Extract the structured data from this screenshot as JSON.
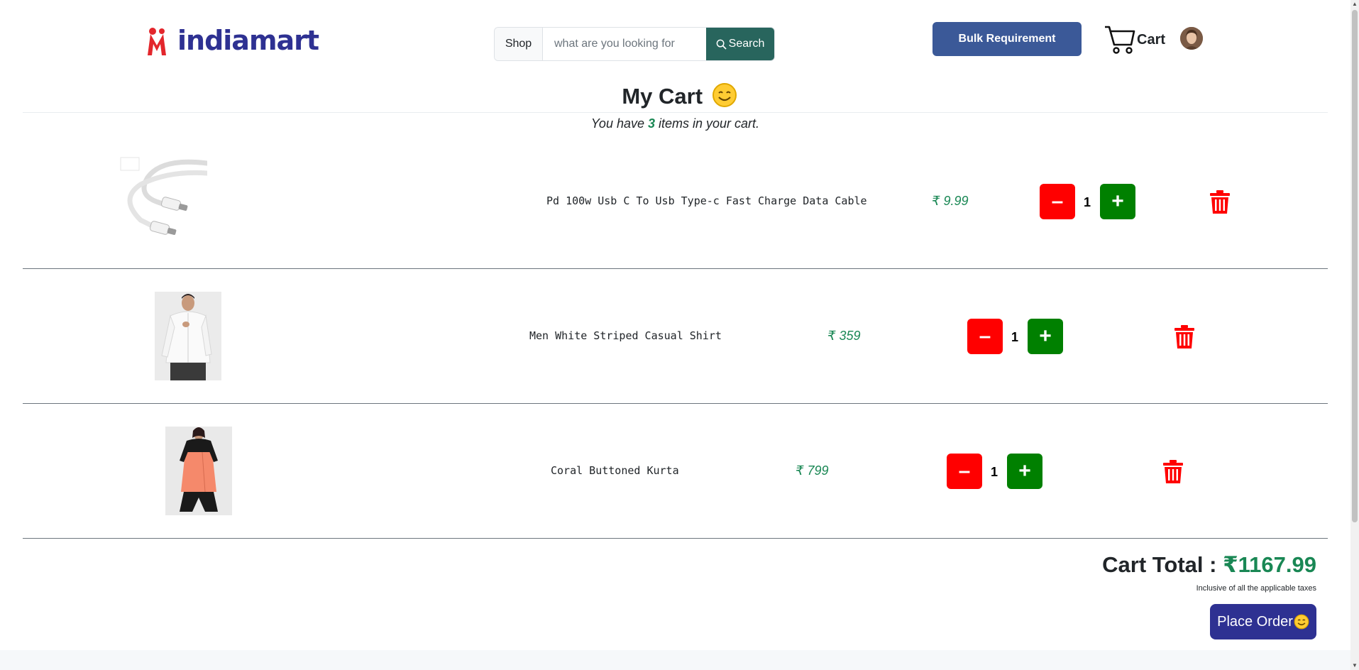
{
  "header": {
    "logo_text": "indiamart",
    "shop_label": "Shop",
    "search_placeholder": "what are you looking for",
    "search_button": "Search",
    "bulk_button": "Bulk Requirement",
    "cart_label": "Cart"
  },
  "main": {
    "title": "My Cart",
    "subtitle_before": "You have ",
    "item_count": "3",
    "subtitle_after": " items in your cart.",
    "items": [
      {
        "name": "Pd 100w Usb C To Usb Type-c Fast Charge Data Cable",
        "price": "₹ 9.99",
        "qty": "1",
        "image": "usb-c-cable"
      },
      {
        "name": "Men White Striped Casual Shirt",
        "price": "₹ 359",
        "qty": "1",
        "image": "white-shirt-model"
      },
      {
        "name": "Coral Buttoned Kurta",
        "price": "₹ 799",
        "qty": "1",
        "image": "coral-kurta-model"
      }
    ],
    "minus_symbol": "–",
    "plus_symbol": "+"
  },
  "summary": {
    "total_label": "Cart Total : ",
    "total_amount": "₹1167.99",
    "tax_note": "Inclusive of all the applicable taxes",
    "place_order": "Place Order"
  },
  "colors": {
    "accent_green": "#198754",
    "minus_red": "#ff0000",
    "plus_green": "#008000",
    "search_button_bg": "#28655d",
    "bulk_button_bg": "#3b5998",
    "place_order_bg": "#2e3192",
    "brand_red": "#e3262c"
  }
}
